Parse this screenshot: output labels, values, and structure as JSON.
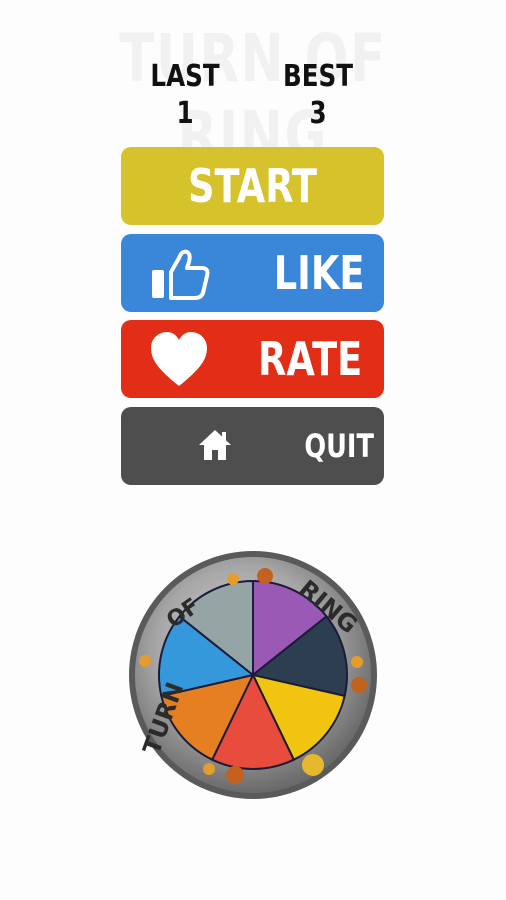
{
  "title": "TURN OF RING",
  "scores": {
    "last_label": "LAST",
    "last_value": "1",
    "best_label": "BEST",
    "best_value": "3"
  },
  "buttons": {
    "start": "START",
    "like": "LIKE",
    "rate": "RATE",
    "quit": "QUIT"
  },
  "logo": {
    "word_turn": "TURN",
    "word_of": "OF",
    "word_ring": "RING",
    "wheel_colors": [
      "#9b59b6",
      "#2c3e50",
      "#f1c40f",
      "#e74c3c",
      "#e67e22",
      "#3498db",
      "#95a5a6"
    ]
  },
  "colors": {
    "start": "#d6c22b",
    "like": "#3a86d8",
    "rate": "#e22e17",
    "quit": "#4e4e4e"
  },
  "icons": {
    "like": "thumbs-up-icon",
    "rate": "heart-icon",
    "quit": "home-icon"
  }
}
